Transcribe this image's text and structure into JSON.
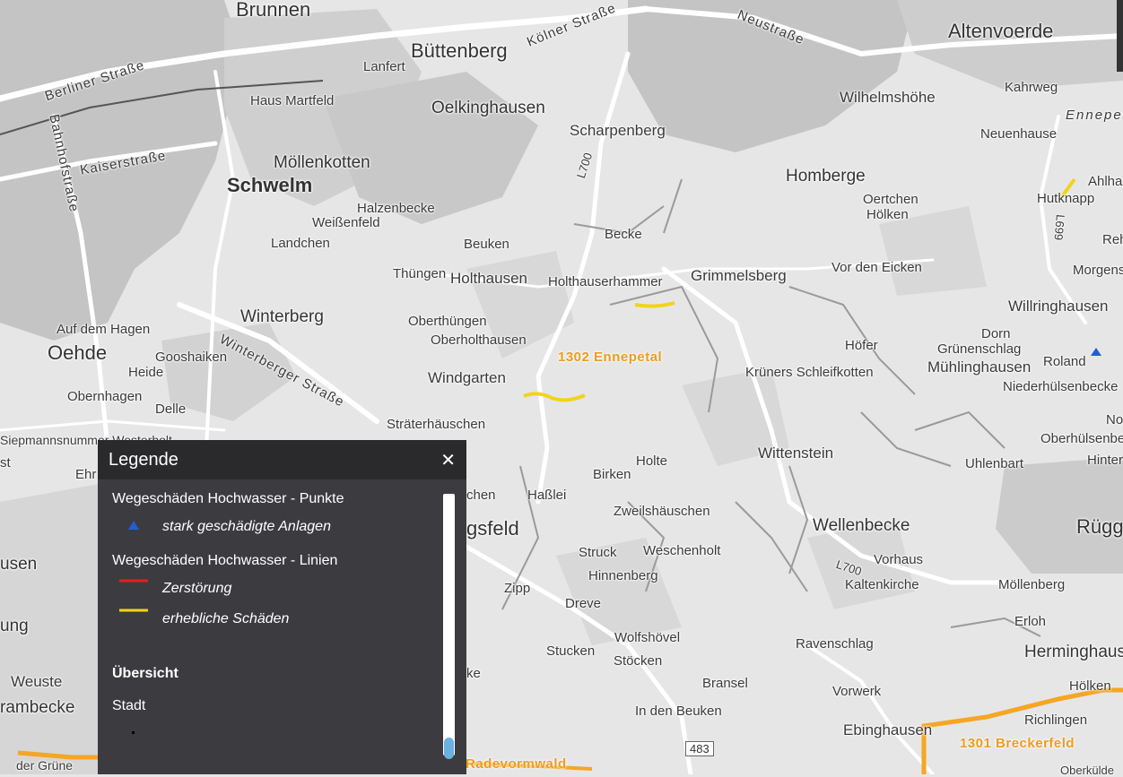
{
  "map": {
    "places": [
      {
        "id": "brunnen",
        "text": "Brunnen"
      },
      {
        "id": "buettenberg",
        "text": "Büttenberg"
      },
      {
        "id": "altenvoerde",
        "text": "Altenvoerde"
      },
      {
        "id": "lanfert",
        "text": "Lanfert"
      },
      {
        "id": "kahrweg",
        "text": "Kahrweg"
      },
      {
        "id": "wilhelmshoehe",
        "text": "Wilhelmshöhe"
      },
      {
        "id": "haus-martfeld",
        "text": "Haus Martfeld"
      },
      {
        "id": "oelkinghausen",
        "text": "Oelkinghausen"
      },
      {
        "id": "ennepe",
        "text": "Ennepe"
      },
      {
        "id": "scharpenberg",
        "text": "Scharpenberg"
      },
      {
        "id": "neuenhause",
        "text": "Neuenhause"
      },
      {
        "id": "moellenkotten",
        "text": "Möllenkotten"
      },
      {
        "id": "schwelm",
        "text": "Schwelm"
      },
      {
        "id": "homberge",
        "text": "Homberge"
      },
      {
        "id": "ahlha",
        "text": "Ahlha"
      },
      {
        "id": "oertchen",
        "text": "Oertchen"
      },
      {
        "id": "hoelken",
        "text": "Hölken"
      },
      {
        "id": "hutknapp",
        "text": "Hutknapp"
      },
      {
        "id": "halzenbecke",
        "text": "Halzenbecke"
      },
      {
        "id": "weissenfeld",
        "text": "Weißenfeld"
      },
      {
        "id": "becke",
        "text": "Becke"
      },
      {
        "id": "landchen",
        "text": "Landchen"
      },
      {
        "id": "beuken",
        "text": "Beuken"
      },
      {
        "id": "reh",
        "text": "Reh"
      },
      {
        "id": "morgens",
        "text": "Morgens"
      },
      {
        "id": "thuengen",
        "text": "Thüngen"
      },
      {
        "id": "holthausen",
        "text": "Holthausen"
      },
      {
        "id": "vor-den-eicken",
        "text": "Vor den Eicken"
      },
      {
        "id": "holthauserhammer",
        "text": "Holthauserhammer"
      },
      {
        "id": "grimmelsberg",
        "text": "Grimmelsberg"
      },
      {
        "id": "willringhausen",
        "text": "Willringhausen"
      },
      {
        "id": "winterberg",
        "text": "Winterberg"
      },
      {
        "id": "oberthuengen",
        "text": "Oberthüngen"
      },
      {
        "id": "auf-dem-hagen",
        "text": "Auf dem Hagen"
      },
      {
        "id": "dorn",
        "text": "Dorn"
      },
      {
        "id": "oberholthausen",
        "text": "Oberholthausen"
      },
      {
        "id": "gruenenschlag",
        "text": "Grünenschlag"
      },
      {
        "id": "hoefer",
        "text": "Höfer"
      },
      {
        "id": "oehde",
        "text": "Oehde"
      },
      {
        "id": "gooshaiken",
        "text": "Gooshaiken"
      },
      {
        "id": "muehlinghausen",
        "text": "Mühlinghausen"
      },
      {
        "id": "roland",
        "text": "Roland"
      },
      {
        "id": "heide",
        "text": "Heide"
      },
      {
        "id": "windgarten",
        "text": "Windgarten"
      },
      {
        "id": "kruners",
        "text": "Krüners Schleifkotten"
      },
      {
        "id": "niederhuelsenbecke",
        "text": "Niederhülsenbecke"
      },
      {
        "id": "obernhagen",
        "text": "Obernhagen"
      },
      {
        "id": "delle",
        "text": "Delle"
      },
      {
        "id": "straeterhaeuschen",
        "text": "Sträterhäuschen"
      },
      {
        "id": "no",
        "text": "No"
      },
      {
        "id": "siepmannsnummer",
        "text": "Siepmannsnummer Westerholt"
      },
      {
        "id": "oberhuelsenbecke",
        "text": "Oberhülsenbecke"
      },
      {
        "id": "wittenstein",
        "text": "Wittenstein"
      },
      {
        "id": "holte",
        "text": "Holte"
      },
      {
        "id": "hinter",
        "text": "Hinter"
      },
      {
        "id": "uhlenbart",
        "text": "Uhlenbart"
      },
      {
        "id": "birken",
        "text": "Birken"
      },
      {
        "id": "st",
        "text": "st"
      },
      {
        "id": "ehr",
        "text": "Ehr"
      },
      {
        "id": "chen",
        "text": "chen"
      },
      {
        "id": "hasslei",
        "text": "Haßlei"
      },
      {
        "id": "rueggeberg",
        "text": "Rügg"
      },
      {
        "id": "zweilshaeuschen",
        "text": "Zweilshäuschen"
      },
      {
        "id": "gsfeld",
        "text": "gsfeld"
      },
      {
        "id": "wellenbecke",
        "text": "Wellenbecke"
      },
      {
        "id": "struck",
        "text": "Struck"
      },
      {
        "id": "weschenholt",
        "text": "Weschenholt"
      },
      {
        "id": "vorhaus",
        "text": "Vorhaus"
      },
      {
        "id": "usen",
        "text": "usen"
      },
      {
        "id": "hinnenberg",
        "text": "Hinnenberg"
      },
      {
        "id": "kaltenkirche",
        "text": "Kaltenkirche"
      },
      {
        "id": "moellenberg",
        "text": "Möllenberg"
      },
      {
        "id": "zipp",
        "text": "Zipp"
      },
      {
        "id": "dreve",
        "text": "Dreve"
      },
      {
        "id": "erloh",
        "text": "Erloh"
      },
      {
        "id": "ung",
        "text": "ung"
      },
      {
        "id": "wolfshoevel",
        "text": "Wolfshövel"
      },
      {
        "id": "ravenschlag",
        "text": "Ravenschlag"
      },
      {
        "id": "herminghaus",
        "text": "Herminghaus"
      },
      {
        "id": "stucken",
        "text": "Stucken"
      },
      {
        "id": "stoecken",
        "text": "Stöcken"
      },
      {
        "id": "ke",
        "text": "ke"
      },
      {
        "id": "weuste",
        "text": "Weuste"
      },
      {
        "id": "bransel",
        "text": "Bransel"
      },
      {
        "id": "vorwerk",
        "text": "Vorwerk"
      },
      {
        "id": "hoelken2",
        "text": "Hölken"
      },
      {
        "id": "rambecke",
        "text": "rambecke"
      },
      {
        "id": "in-den-beuken",
        "text": "In den Beuken"
      },
      {
        "id": "richlingen",
        "text": "Richlingen"
      },
      {
        "id": "ebinghausen",
        "text": "Ebinghausen"
      },
      {
        "id": "der-gruene",
        "text": "der Grüne"
      },
      {
        "id": "oberkuelde",
        "text": "Oberkülde"
      }
    ],
    "streets": [
      {
        "id": "berliner",
        "text": "Berliner Straße"
      },
      {
        "id": "koelner",
        "text": "Kölner Straße"
      },
      {
        "id": "neustrasse",
        "text": "Neustraße"
      },
      {
        "id": "bahnhofstrasse",
        "text": "Bahnhofstraße"
      },
      {
        "id": "kaiserstrasse",
        "text": "Kaiserstraße"
      },
      {
        "id": "winterberger",
        "text": "Winterberger Straße"
      },
      {
        "id": "l700a",
        "text": "L700"
      },
      {
        "id": "l700b",
        "text": "L700"
      },
      {
        "id": "l699",
        "text": "L699"
      }
    ],
    "districts": [
      {
        "id": "ennepetal",
        "text": "1302 Ennepetal"
      },
      {
        "id": "breckerfeld",
        "text": "1301 Breckerfeld"
      },
      {
        "id": "radevormwald",
        "text": "Radevormwald"
      }
    ],
    "shields": [
      {
        "id": "b483",
        "text": "483"
      }
    ],
    "colors": {
      "background": "#e6e6e6",
      "road": "#ffffff",
      "urban": "#bfbfbf",
      "district_border": "#f5a623",
      "damage_line": "#f2d31b",
      "point": "#1e5fd6"
    }
  },
  "legend": {
    "title": "Legende",
    "close_icon": "close-icon",
    "sections": [
      {
        "heading": "Wegeschäden Hochwasser - Punkte",
        "items": [
          {
            "label": "stark geschädigte Anlagen",
            "symbol": "blue-triangle",
            "color": "#1e5fd6"
          }
        ]
      },
      {
        "heading": "Wegeschäden Hochwasser - Linien",
        "items": [
          {
            "label": "Zerstörung",
            "symbol": "line",
            "color": "#e02020"
          },
          {
            "label": "erhebliche Schäden",
            "symbol": "line",
            "color": "#f2d31b"
          }
        ]
      }
    ],
    "overview_heading": "Übersicht",
    "overview_item": "Stadt"
  }
}
